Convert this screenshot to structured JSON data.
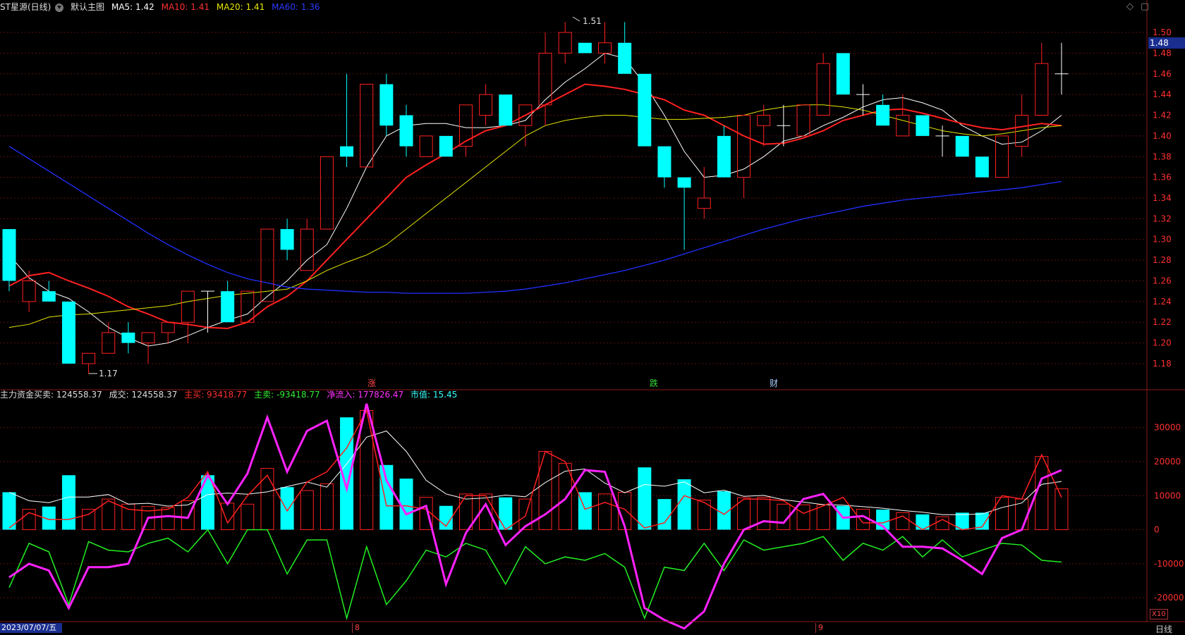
{
  "header": {
    "stock": "ST星源(日线)",
    "template": "默认主图",
    "ma5": "MA5: 1.42",
    "ma10": "MA10: 1.41",
    "ma20": "MA20: 1.41",
    "ma60": "MA60: 1.36",
    "colors": {
      "ma5": "#ffffff",
      "ma10": "#ff2020",
      "ma20": "#e6e600",
      "ma60": "#2030ff"
    }
  },
  "indicator_header": {
    "name": "主力资金买卖",
    "value": ": 124558.37",
    "cjl": "成交: 124558.37",
    "buy": "主买: 93418.77",
    "sell": "主卖: -93418.77",
    "inflow": "净流入: 177826.47",
    "mktval": "市值: 15.45"
  },
  "annotations": {
    "high": "1.51",
    "low": "1.17",
    "zhang": "涨",
    "die": "跌",
    "cai": "财"
  },
  "current_price": "1.48",
  "scale_badge": "X10",
  "date_label": "2023/07/07/五",
  "month_labels": [
    "8",
    "9"
  ],
  "period": "日线",
  "icons": [
    "diamond-icon",
    "restore-icon",
    "dropdown-icon"
  ],
  "chart_data": [
    {
      "type": "candlestick",
      "title": "ST星源(日线)",
      "ylim": [
        1.165,
        1.515
      ],
      "yticks": [
        1.18,
        1.2,
        1.22,
        1.24,
        1.26,
        1.28,
        1.3,
        1.32,
        1.34,
        1.36,
        1.38,
        1.4,
        1.42,
        1.44,
        1.46,
        1.48,
        1.5
      ],
      "ohlc": [
        [
          1.31,
          1.31,
          1.25,
          1.26
        ],
        [
          1.24,
          1.27,
          1.23,
          1.26
        ],
        [
          1.25,
          1.26,
          1.25,
          1.24
        ],
        [
          1.24,
          1.24,
          1.18,
          1.18
        ],
        [
          1.18,
          1.19,
          1.17,
          1.19
        ],
        [
          1.19,
          1.22,
          1.19,
          1.21
        ],
        [
          1.21,
          1.22,
          1.19,
          1.2
        ],
        [
          1.2,
          1.21,
          1.18,
          1.21
        ],
        [
          1.21,
          1.22,
          1.2,
          1.22
        ],
        [
          1.22,
          1.25,
          1.2,
          1.25
        ],
        [
          1.25,
          1.25,
          1.21,
          1.25
        ],
        [
          1.25,
          1.26,
          1.22,
          1.22
        ],
        [
          1.22,
          1.25,
          1.22,
          1.25
        ],
        [
          1.24,
          1.31,
          1.24,
          1.31
        ],
        [
          1.31,
          1.32,
          1.28,
          1.29
        ],
        [
          1.27,
          1.32,
          1.27,
          1.31
        ],
        [
          1.31,
          1.38,
          1.31,
          1.38
        ],
        [
          1.39,
          1.46,
          1.37,
          1.38
        ],
        [
          1.37,
          1.45,
          1.37,
          1.45
        ],
        [
          1.45,
          1.46,
          1.4,
          1.41
        ],
        [
          1.42,
          1.43,
          1.38,
          1.39
        ],
        [
          1.38,
          1.4,
          1.38,
          1.4
        ],
        [
          1.4,
          1.4,
          1.38,
          1.38
        ],
        [
          1.39,
          1.43,
          1.38,
          1.43
        ],
        [
          1.42,
          1.45,
          1.41,
          1.44
        ],
        [
          1.44,
          1.44,
          1.41,
          1.41
        ],
        [
          1.41,
          1.43,
          1.39,
          1.43
        ],
        [
          1.43,
          1.5,
          1.41,
          1.48
        ],
        [
          1.48,
          1.51,
          1.47,
          1.5
        ],
        [
          1.49,
          1.49,
          1.48,
          1.48
        ],
        [
          1.48,
          1.51,
          1.47,
          1.49
        ],
        [
          1.49,
          1.51,
          1.46,
          1.46
        ],
        [
          1.46,
          1.46,
          1.39,
          1.39
        ],
        [
          1.39,
          1.39,
          1.35,
          1.36
        ],
        [
          1.36,
          1.36,
          1.29,
          1.35
        ],
        [
          1.33,
          1.37,
          1.32,
          1.34
        ],
        [
          1.4,
          1.41,
          1.36,
          1.36
        ],
        [
          1.36,
          1.42,
          1.34,
          1.42
        ],
        [
          1.41,
          1.43,
          1.39,
          1.42
        ],
        [
          1.41,
          1.43,
          1.39,
          1.41
        ],
        [
          1.4,
          1.43,
          1.4,
          1.43
        ],
        [
          1.42,
          1.48,
          1.42,
          1.47
        ],
        [
          1.48,
          1.48,
          1.44,
          1.44
        ],
        [
          1.44,
          1.45,
          1.42,
          1.44
        ],
        [
          1.43,
          1.44,
          1.41,
          1.41
        ],
        [
          1.4,
          1.44,
          1.4,
          1.42
        ],
        [
          1.42,
          1.42,
          1.4,
          1.4
        ],
        [
          1.4,
          1.41,
          1.38,
          1.4
        ],
        [
          1.4,
          1.4,
          1.38,
          1.38
        ],
        [
          1.38,
          1.38,
          1.36,
          1.36
        ],
        [
          1.36,
          1.4,
          1.36,
          1.4
        ],
        [
          1.39,
          1.44,
          1.38,
          1.42
        ],
        [
          1.42,
          1.49,
          1.42,
          1.47
        ],
        [
          1.46,
          1.49,
          1.44,
          1.46
        ]
      ],
      "ma": {
        "MA5": [
          1.285,
          1.263,
          1.25,
          1.243,
          1.23,
          1.215,
          1.205,
          1.197,
          1.2,
          1.207,
          1.215,
          1.222,
          1.228,
          1.245,
          1.26,
          1.28,
          1.295,
          1.33,
          1.37,
          1.4,
          1.41,
          1.412,
          1.412,
          1.408,
          1.408,
          1.41,
          1.415,
          1.435,
          1.452,
          1.465,
          1.48,
          1.475,
          1.45,
          1.42,
          1.385,
          1.36,
          1.362,
          1.368,
          1.38,
          1.395,
          1.4,
          1.41,
          1.418,
          1.428,
          1.435,
          1.437,
          1.432,
          1.425,
          1.41,
          1.4,
          1.392,
          1.394,
          1.405,
          1.42
        ],
        "MA10": [
          1.255,
          1.265,
          1.268,
          1.26,
          1.253,
          1.245,
          1.235,
          1.228,
          1.22,
          1.218,
          1.215,
          1.214,
          1.22,
          1.235,
          1.245,
          1.26,
          1.28,
          1.3,
          1.32,
          1.34,
          1.36,
          1.372,
          1.383,
          1.395,
          1.405,
          1.41,
          1.42,
          1.43,
          1.44,
          1.45,
          1.448,
          1.445,
          1.44,
          1.435,
          1.425,
          1.42,
          1.41,
          1.4,
          1.392,
          1.393,
          1.398,
          1.405,
          1.415,
          1.42,
          1.425,
          1.426,
          1.422,
          1.417,
          1.412,
          1.408,
          1.406,
          1.409,
          1.412,
          1.41
        ],
        "MA20": [
          1.215,
          1.218,
          1.225,
          1.227,
          1.228,
          1.23,
          1.232,
          1.234,
          1.236,
          1.24,
          1.243,
          1.246,
          1.248,
          1.25,
          1.252,
          1.26,
          1.27,
          1.278,
          1.285,
          1.295,
          1.31,
          1.325,
          1.34,
          1.355,
          1.37,
          1.385,
          1.4,
          1.41,
          1.415,
          1.418,
          1.42,
          1.42,
          1.418,
          1.416,
          1.416,
          1.417,
          1.418,
          1.42,
          1.425,
          1.428,
          1.43,
          1.43,
          1.428,
          1.425,
          1.42,
          1.415,
          1.41,
          1.405,
          1.402,
          1.4,
          1.402,
          1.405,
          1.408,
          1.41
        ],
        "MA60": [
          1.39,
          1.378,
          1.366,
          1.354,
          1.342,
          1.33,
          1.318,
          1.306,
          1.295,
          1.285,
          1.276,
          1.268,
          1.262,
          1.258,
          1.254,
          1.252,
          1.251,
          1.25,
          1.249,
          1.249,
          1.248,
          1.248,
          1.248,
          1.248,
          1.249,
          1.25,
          1.252,
          1.255,
          1.258,
          1.262,
          1.266,
          1.27,
          1.275,
          1.28,
          1.286,
          1.292,
          1.298,
          1.304,
          1.31,
          1.315,
          1.32,
          1.324,
          1.328,
          1.332,
          1.335,
          1.338,
          1.34,
          1.342,
          1.344,
          1.346,
          1.348,
          1.35,
          1.353,
          1.356
        ]
      }
    },
    {
      "type": "bar+line",
      "title": "主力资金买卖",
      "ylim": [
        -27000,
        38000
      ],
      "yticks": [
        -20000,
        -10000,
        0,
        10000,
        20000,
        30000
      ],
      "volume": [
        11000,
        6000,
        6800,
        16000,
        6000,
        9000,
        7500,
        6800,
        6500,
        8500,
        16000,
        7800,
        7500,
        18000,
        12500,
        11500,
        13500,
        33000,
        35000,
        19000,
        15000,
        9500,
        7000,
        10500,
        10500,
        9500,
        9000,
        23000,
        19500,
        11000,
        10500,
        11000,
        18300,
        9000,
        14800,
        8700,
        11300,
        9400,
        9500,
        7500,
        7300,
        7300,
        7000,
        6000,
        5900,
        5000,
        4500,
        3800,
        5000,
        5000,
        9500,
        9000,
        21500,
        12000
      ],
      "volume_up": [
        false,
        true,
        false,
        false,
        true,
        true,
        true,
        true,
        true,
        true,
        false,
        true,
        true,
        true,
        false,
        true,
        true,
        false,
        true,
        false,
        false,
        true,
        false,
        true,
        true,
        false,
        true,
        true,
        true,
        false,
        true,
        true,
        false,
        false,
        false,
        true,
        false,
        true,
        true,
        true,
        true,
        true,
        false,
        true,
        false,
        true,
        false,
        true,
        false,
        false,
        true,
        true,
        true,
        true
      ],
      "buy": [
        500,
        5000,
        3000,
        3000,
        4500,
        8500,
        6000,
        5500,
        6000,
        9500,
        17000,
        2000,
        10000,
        16000,
        5500,
        14000,
        17000,
        24000,
        35000,
        7000,
        7000,
        6000,
        1000,
        10000,
        10000,
        0,
        4000,
        23000,
        20000,
        6000,
        8000,
        6000,
        500,
        2000,
        10000,
        8000,
        4500,
        9000,
        9000,
        8500,
        4800,
        7000,
        9500,
        2000,
        2000,
        4000,
        0,
        3000,
        0,
        800,
        10000,
        9000,
        22000,
        9500
      ],
      "sell": [
        -17000,
        -4000,
        -6500,
        -22000,
        -3500,
        -6000,
        -6500,
        -4000,
        -2500,
        -6500,
        0,
        -10000,
        0,
        0,
        -13000,
        -3000,
        -3000,
        -26000,
        -5000,
        -22000,
        -15000,
        -6000,
        -8000,
        -4000,
        -6000,
        -16000,
        -5000,
        -10000,
        -8000,
        -9000,
        -7000,
        -11000,
        -26000,
        -11000,
        -12000,
        -4000,
        -12000,
        -3000,
        -6000,
        -5000,
        -4000,
        -2000,
        -9000,
        -4000,
        -6000,
        -2000,
        -8000,
        -3000,
        -8000,
        -6000,
        -4000,
        -4500,
        -9000,
        -9500
      ],
      "net": [
        -14000,
        -10000,
        -12000,
        -23000,
        -11000,
        -11000,
        -10000,
        3500,
        4000,
        3500,
        16000,
        7500,
        16500,
        33000,
        17000,
        29000,
        32000,
        12000,
        37000,
        14500,
        4500,
        7000,
        -16000,
        -1000,
        7500,
        -4500,
        1000,
        4500,
        9000,
        17500,
        17000,
        1000,
        -23000,
        -26500,
        -29000,
        -24000,
        -10000,
        0,
        2500,
        2000,
        9000,
        10500,
        3500,
        4000,
        1000,
        -5000,
        -5000,
        -5500,
        -9000,
        -13000,
        -2500,
        0,
        15000,
        17500
      ]
    }
  ]
}
